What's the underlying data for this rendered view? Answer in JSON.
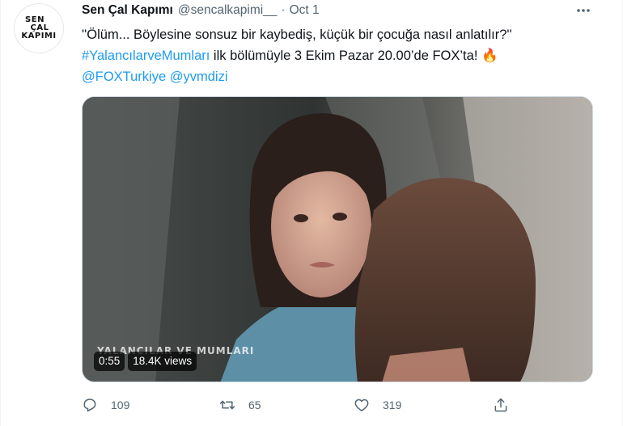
{
  "tweet": {
    "avatar_text": [
      "SEN",
      "ÇAL",
      "KAPIMI"
    ],
    "display_name": "Sen Çal Kapımı",
    "handle": "@sencalkapimi__",
    "separator": "·",
    "timestamp": "Oct 1",
    "body_line1": "''Ölüm... Böylesine sonsuz bir kaybediş, küçük bir çocuğa nasıl anlatılır?''",
    "hashtag": "#YalancılarveMumları",
    "body_line2_rest": " ilk bölümüyle 3 Ekim Pazar 20.00’de FOX’ta! 🔥",
    "mention1": "@FOXTurkiye",
    "mention2": "@yvmdizi"
  },
  "media": {
    "overlay_title": "YALANCILAR VE MUMLARI",
    "duration": "0:55",
    "views": "18.4K views"
  },
  "actions": {
    "replies": "109",
    "retweets": "65",
    "likes": "319"
  },
  "icons": {
    "more": "more-horizontal-icon",
    "reply": "reply-icon",
    "retweet": "retweet-icon",
    "like": "heart-icon",
    "share": "share-icon"
  },
  "colors": {
    "link": "#1d9bf0",
    "secondary_text": "#536471",
    "primary_text": "#0f1419"
  }
}
